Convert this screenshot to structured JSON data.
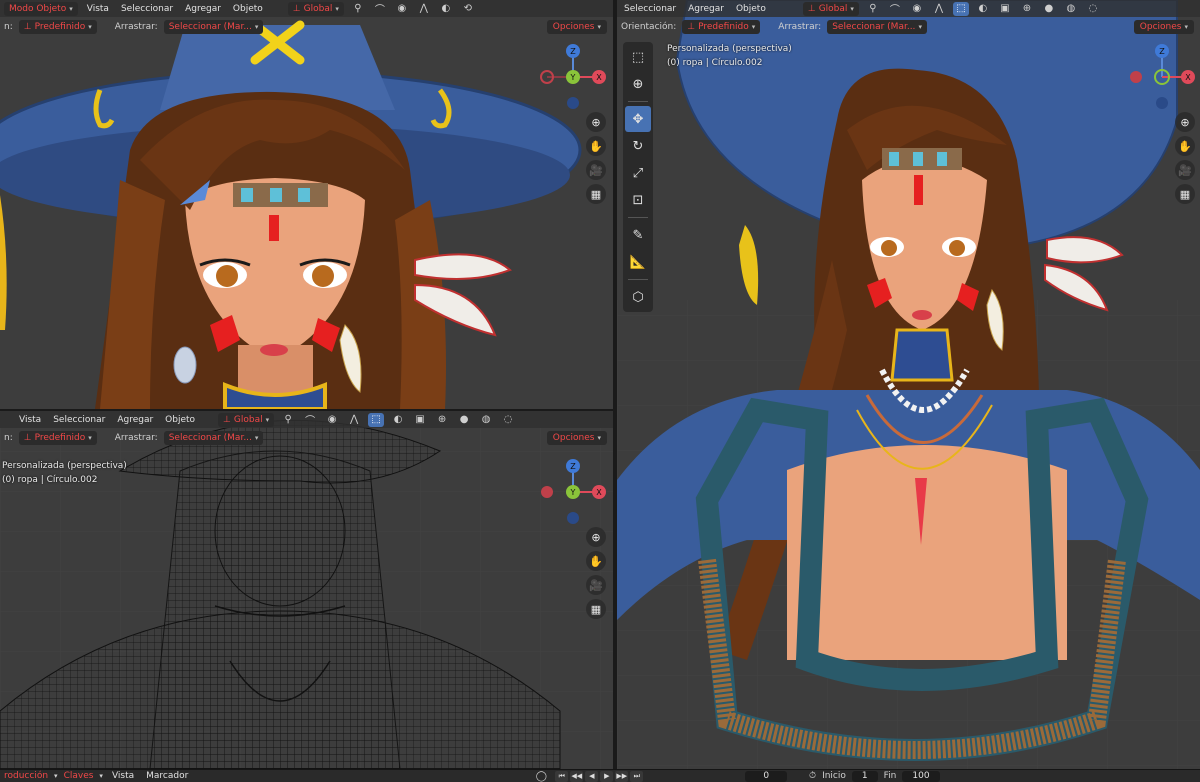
{
  "top_left": {
    "mode": "Modo Objeto",
    "menus": [
      "Vista",
      "Seleccionar",
      "Agregar",
      "Objeto"
    ],
    "transform": "Global",
    "orientation_label": "n:",
    "orientation_value": "Predefinido",
    "drag_label": "Arrastrar:",
    "drag_value": "Seleccionar (Mar...",
    "options": "Opciones"
  },
  "bottom_left": {
    "menus": [
      "Vista",
      "Seleccionar",
      "Agregar",
      "Objeto"
    ],
    "transform": "Global",
    "orientation_label": "n:",
    "orientation_value": "Predefinido",
    "drag_label": "Arrastrar:",
    "drag_value": "Seleccionar (Mar...",
    "options": "Opciones",
    "view_name": "Personalizada (perspectiva)",
    "object_info": "(0) ropa | Círculo.002"
  },
  "right": {
    "menus": [
      "Seleccionar",
      "Agregar",
      "Objeto"
    ],
    "transform": "Global",
    "orientation_label": "Orientación:",
    "orientation_value": "Predefinido",
    "drag_label": "Arrastrar:",
    "drag_value": "Seleccionar (Mar...",
    "options": "Opciones",
    "view_name": "Personalizada (perspectiva)",
    "object_info": "(0) ropa | Círculo.002"
  },
  "gizmo": {
    "z": "Z",
    "y": "Y",
    "x": "X"
  },
  "timeline": {
    "mode": "roducción",
    "keys": "Claves",
    "view": "Vista",
    "marker": "Marcador",
    "current_frame": "0",
    "start_label": "Inicio",
    "start_value": "1",
    "end_label": "Fin",
    "end_value": "100"
  },
  "colors": {
    "hat": "#3b5f9e",
    "hair": "#5a2e12",
    "skin": "#e8a27a",
    "accent_red": "#e02020",
    "viewport": "#3d3d3d",
    "active_tool": "#4772b3"
  }
}
